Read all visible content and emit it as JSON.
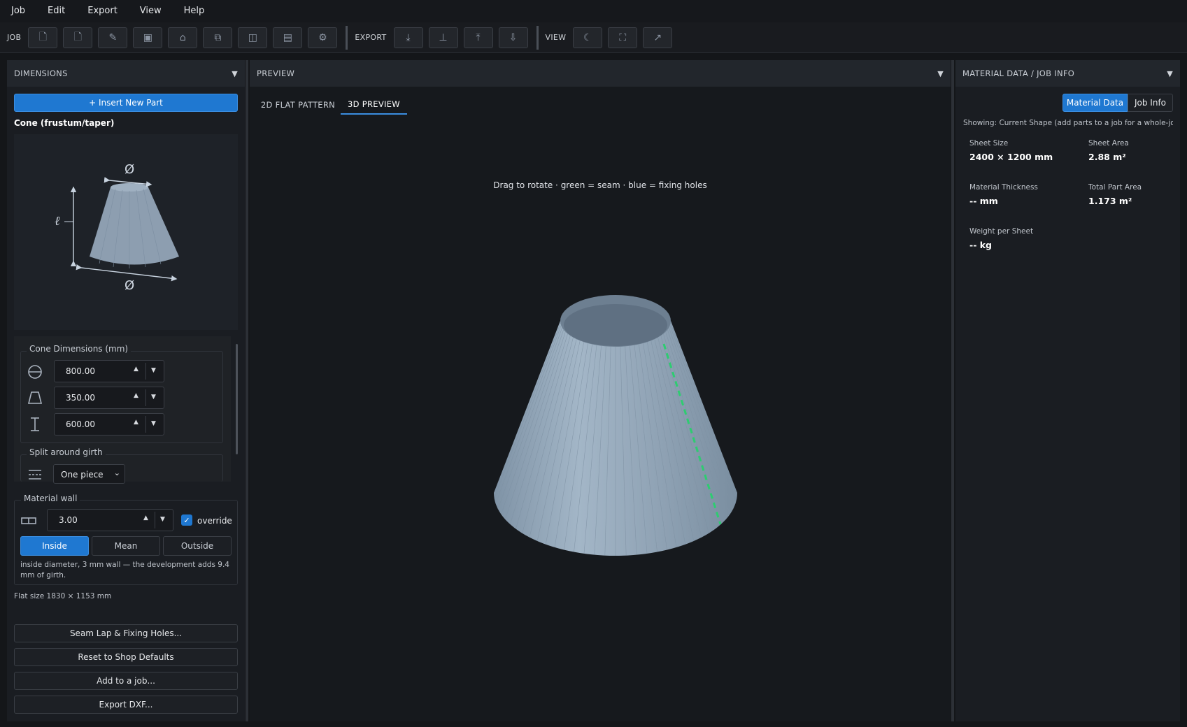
{
  "menu": [
    "Job",
    "Edit",
    "Export",
    "View",
    "Help"
  ],
  "toolbar": {
    "job_label": "JOB",
    "export_label": "EXPORT",
    "view_label": "VIEW"
  },
  "left": {
    "header": "DIMENSIONS",
    "insert_button": "+ Insert New Part",
    "shape_title": "Cone (frustum/taper)",
    "thumb_top_symbol": "Ø",
    "thumb_bottom_symbol": "Ø",
    "thumb_side_symbol": "ℓ",
    "dims_group": "Cone Dimensions (mm)",
    "dim_large": "800.00",
    "dim_small": "350.00",
    "dim_height": "600.00",
    "split_label": "Split around girth",
    "split_value": "One piece",
    "wall_group": "Material wall",
    "wall_value": "3.00",
    "override_label": "override",
    "seg_inside": "Inside",
    "seg_mean": "Mean",
    "seg_outside": "Outside",
    "wall_note": "inside diameter, 3 mm wall — the development adds 9.4 mm of girth.",
    "flat_size": "Flat size 1830 × 1153 mm",
    "btn_seam": "Seam Lap & Fixing Holes...",
    "btn_reset": "Reset to Shop Defaults",
    "btn_add": "Add to a job...",
    "btn_export": "Export DXF..."
  },
  "center": {
    "header": "PREVIEW",
    "tab_2d": "2D FLAT PATTERN",
    "tab_3d": "3D PREVIEW",
    "hint": "Drag to rotate · green = seam · blue = fixing holes"
  },
  "right": {
    "header": "MATERIAL DATA / JOB INFO",
    "toggle_material": "Material Data",
    "toggle_job": "Job Info",
    "showing": "Showing: Current Shape (add parts to a job for a whole-job to",
    "sheet_size_label": "Sheet Size",
    "sheet_size_value": "2400 × 1200 mm",
    "sheet_area_label": "Sheet Area",
    "sheet_area_value": "2.88 m²",
    "thickness_label": "Material Thickness",
    "thickness_value": "-- mm",
    "total_area_label": "Total Part Area",
    "total_area_value": "1.173 m²",
    "weight_label": "Weight per Sheet",
    "weight_value": "-- kg"
  },
  "colors": {
    "accent": "#1f78d1",
    "seam": "#2ecc71",
    "cone": "#8fa3b5"
  }
}
